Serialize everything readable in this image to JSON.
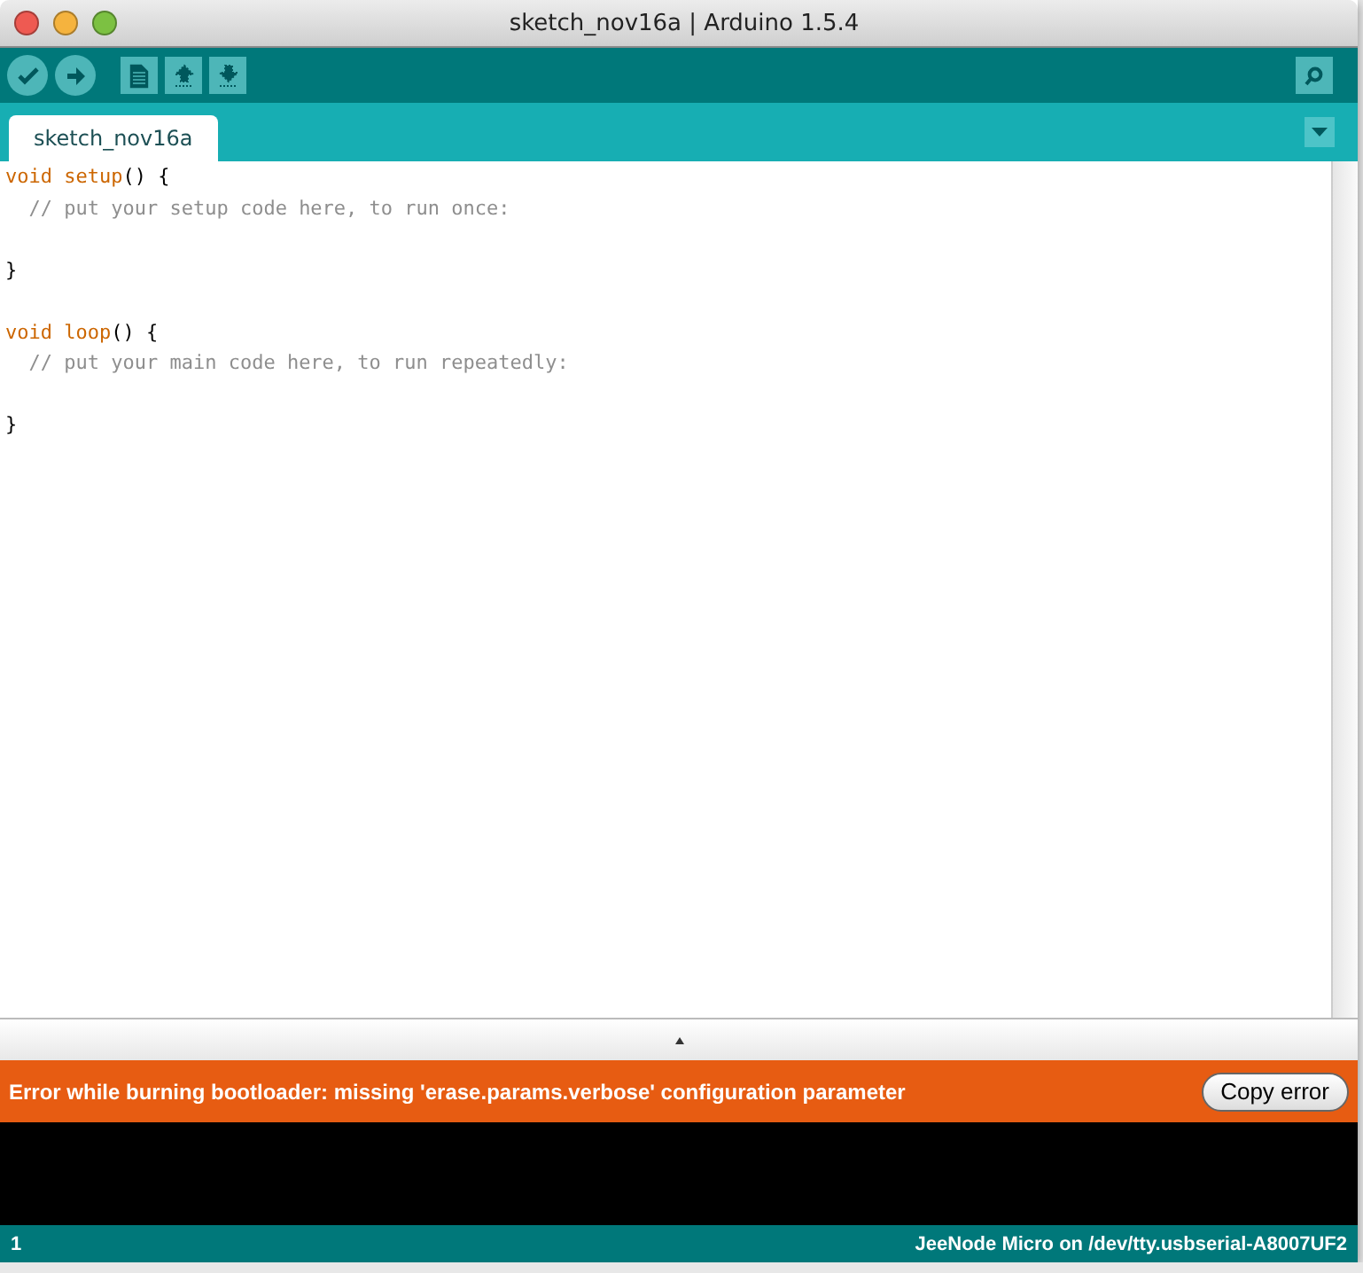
{
  "window": {
    "title": "sketch_nov16a | Arduino 1.5.4"
  },
  "toolbar": {
    "buttons": [
      {
        "kind": "verify"
      },
      {
        "kind": "upload"
      },
      {
        "kind": "new"
      },
      {
        "kind": "open"
      },
      {
        "kind": "save"
      }
    ],
    "serial_monitor": {
      "kind": "monitor"
    }
  },
  "tabs": [
    {
      "label": "sketch_nov16a",
      "selected": true
    }
  ],
  "editor": {
    "lines": [
      {
        "kind": "code",
        "tokens": [
          {
            "kind": "keyword",
            "text": "void "
          },
          {
            "kind": "function",
            "text": "setup"
          },
          {
            "kind": "plain",
            "text": "() {"
          }
        ]
      },
      {
        "kind": "code",
        "tokens": [
          {
            "kind": "comment",
            "text": "  // put your setup code here, to run once:"
          }
        ]
      },
      {
        "kind": "blank"
      },
      {
        "kind": "code",
        "tokens": [
          {
            "kind": "plain",
            "text": "}"
          }
        ]
      },
      {
        "kind": "blank"
      },
      {
        "kind": "code",
        "tokens": [
          {
            "kind": "keyword",
            "text": "void "
          },
          {
            "kind": "function",
            "text": "loop"
          },
          {
            "kind": "plain",
            "text": "() {"
          }
        ]
      },
      {
        "kind": "code",
        "tokens": [
          {
            "kind": "comment",
            "text": "  // put your main code here, to run repeatedly:"
          }
        ]
      },
      {
        "kind": "blank"
      },
      {
        "kind": "code",
        "tokens": [
          {
            "kind": "plain",
            "text": "}"
          }
        ]
      }
    ]
  },
  "message_bar": {
    "kind": "error",
    "text": "Error while burning bootloader: missing 'erase.params.verbose' configuration parameter",
    "button": "Copy error"
  },
  "status_bar": {
    "line": "1",
    "board": "JeeNode Micro on /dev/tty.usbserial-A8007UF2"
  }
}
